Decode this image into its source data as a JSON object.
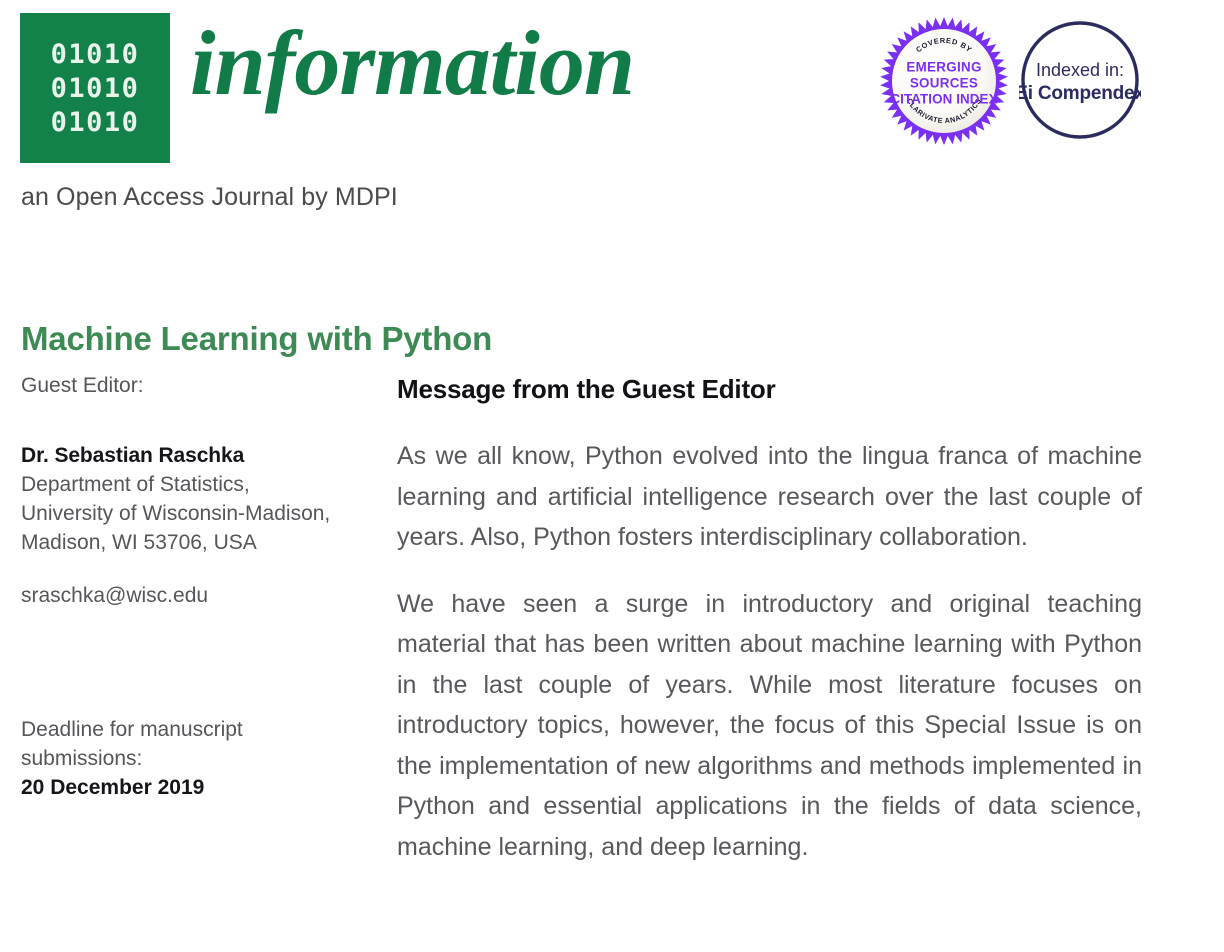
{
  "journal": {
    "logo_bits_rows": [
      "01010",
      "01010",
      "01010"
    ],
    "wordmark": "information",
    "subtitle": "an Open Access Journal by MDPI",
    "brand_green": "#127c48",
    "title_green": "#3d8a55"
  },
  "badges": {
    "esci": {
      "name": "emerging-sources-citation-index-badge",
      "arc_top": "COVERED BY",
      "line1": "EMERGING",
      "line2": "SOURCES",
      "line3": "CITATION INDEX",
      "arc_bottom": "CLARIVATE ANALYTICS",
      "color": "#7b2ff2"
    },
    "ei": {
      "name": "ei-compendex-badge",
      "line1": "Indexed in:",
      "line2": "Ei Compendex",
      "color": "#2b2b60"
    }
  },
  "special_issue": {
    "title": "Machine Learning with Python"
  },
  "guest_editor": {
    "label": "Guest Editor:",
    "name": "Dr. Sebastian Raschka",
    "affiliation": [
      "Department of Statistics,",
      "University of Wisconsin-Madison,",
      "Madison, WI 53706, USA"
    ],
    "email": "sraschka@wisc.edu"
  },
  "deadline": {
    "label_line1": "Deadline for manuscript",
    "label_line2": "submissions:",
    "date": "20 December 2019"
  },
  "message": {
    "heading": "Message from the Guest Editor",
    "paragraphs": [
      "As we all know, Python evolved into the lingua franca of machine learning and artificial intelligence research over the last couple of years. Also, Python fosters interdisciplinary collaboration.",
      "We have seen a surge in introductory and original teaching material that has been written about machine learning with Python in the last couple of years. While most literature focuses on introductory topics, however, the focus of this Special Issue is on the implementation of new algorithms and methods implemented in Python and essential applications in the fields of data science, machine learning, and deep learning."
    ]
  }
}
